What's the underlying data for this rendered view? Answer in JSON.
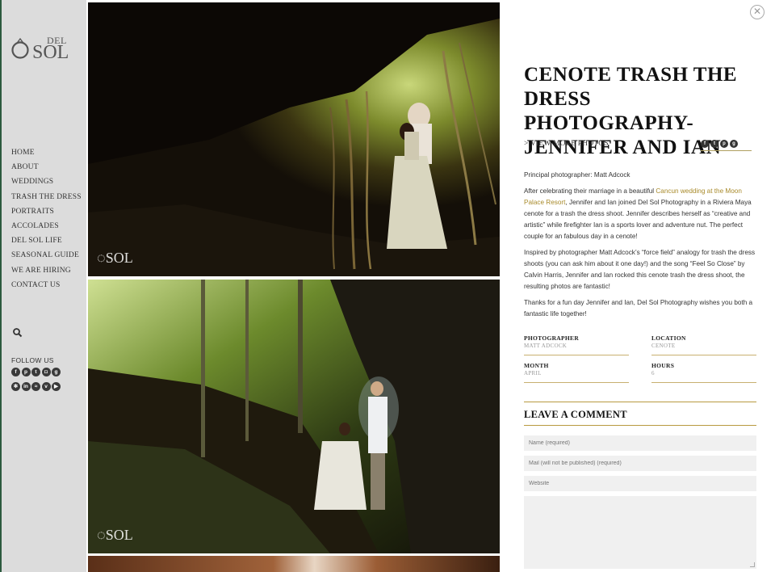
{
  "brand": {
    "del": "DEL",
    "sol": "SOL"
  },
  "nav": [
    "HOME",
    "ABOUT",
    "WEDDINGS",
    "TRASH THE DRESS",
    "PORTRAITS",
    "ACCOLADES",
    "DEL SOL LIFE",
    "SEASONAL GUIDE",
    "WE ARE HIRING",
    "CONTACT US"
  ],
  "follow_label": "FOLLOW US",
  "social_icons": [
    "facebook-icon",
    "pinterest-icon",
    "twitter-icon",
    "instagram-icon",
    "google-plus-icon",
    "flickr-icon",
    "linkedin-icon",
    "rss-icon",
    "vimeo-icon",
    "youtube-icon"
  ],
  "post": {
    "title": "CENOTE TRASH THE DRESS PHOTOGRAPHY- JENNIFER AND IAN",
    "view_more": "> VIEW MORE PHOTOS",
    "share_icons": [
      "facebook-icon",
      "twitter-icon",
      "pinterest-icon",
      "google-plus-icon"
    ],
    "principal": "Principal photographer: Matt Adcock",
    "p1_before": "After celebrating their marriage in a beautiful ",
    "p1_link": "Cancun wedding at the Moon Palace Resort",
    "p1_after": ", Jennifer and Ian joined Del Sol Photography in a Riviera Maya cenote for a trash the dress shoot. Jennifer describes herself as “creative and artistic” while firefighter Ian is a sports lover and adventure nut. The perfect couple for an fabulous day in a cenote!",
    "p2": "Inspired by photographer Matt Adcock’s “force field” analogy for trash the dress shoots (you can ask him about it one day!) and the song “Feel So Close” by Calvin Harris, Jennifer and Ian rocked this cenote trash the dress shoot, the resulting photos are fantastic!",
    "p3": "Thanks for a fun day Jennifer and Ian, Del Sol Photography wishes you both a fantastic life together!"
  },
  "meta": {
    "photographer_label": "PHOTOGRAPHER",
    "photographer": "MATT ADCOCK",
    "location_label": "LOCATION",
    "location": "CENOTE",
    "month_label": "MONTH",
    "month": "APRIL",
    "hours_label": "HOURS",
    "hours": "6"
  },
  "comment": {
    "title": "LEAVE A COMMENT",
    "name_placeholder": "Name (required)",
    "mail_placeholder": "Mail (will not be published) (required)",
    "website_placeholder": "Website"
  },
  "colors": {
    "sidebar": "#dcdcdc",
    "accent": "#a88a2a",
    "rule": "#b89a40"
  }
}
